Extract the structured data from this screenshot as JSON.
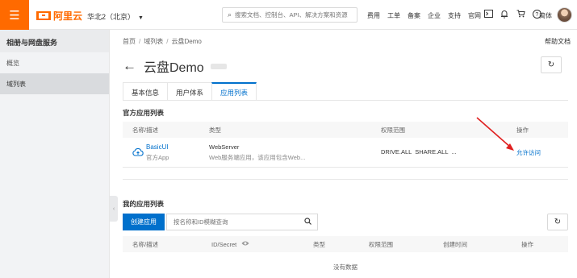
{
  "topbar": {
    "menu_icon": "hamburger-icon",
    "logo_text": "阿里云",
    "region": "华北2（北京）",
    "search_placeholder": "搜索文档、控制台、API、解决方案和资源",
    "nav": [
      "费用",
      "工单",
      "备案",
      "企业",
      "支持",
      "官网"
    ],
    "icons": [
      "terminal-icon",
      "bell-icon",
      "cart-icon",
      "help-icon"
    ],
    "lang": "简体",
    "brand_color": "#ff6a00"
  },
  "sidebar": {
    "title": "相册与网盘服务",
    "items": [
      {
        "label": "概览",
        "active": false
      },
      {
        "label": "域列表",
        "active": true
      }
    ]
  },
  "main": {
    "breadcrumb": [
      "首页",
      "域列表",
      "云盘Demo"
    ],
    "help": "帮助文档",
    "title": "云盘Demo",
    "tabs": [
      {
        "label": "基本信息",
        "active": false
      },
      {
        "label": "用户体系",
        "active": false
      },
      {
        "label": "应用列表",
        "active": true
      }
    ],
    "official": {
      "title": "官方应用列表",
      "headers": [
        "名称/描述",
        "类型",
        "权限范围",
        "操作"
      ],
      "rows": [
        {
          "name": "BasicUI",
          "sub": "官方App",
          "type": "WebServer",
          "type_sub": "Web服务端应用，该应用包含Web...",
          "scope": "DRIVE.ALL  SHARE.ALL  ...",
          "action": "允许访问"
        }
      ]
    },
    "mine": {
      "title": "我的应用列表",
      "create_button": "创建应用",
      "search_placeholder": "按名称和ID模糊查询",
      "headers": [
        "名称/描述",
        "ID/Secret",
        "类型",
        "权限范围",
        "创建时间",
        "操作"
      ],
      "empty": "没有数据"
    },
    "accent_color": "#0070cc"
  }
}
